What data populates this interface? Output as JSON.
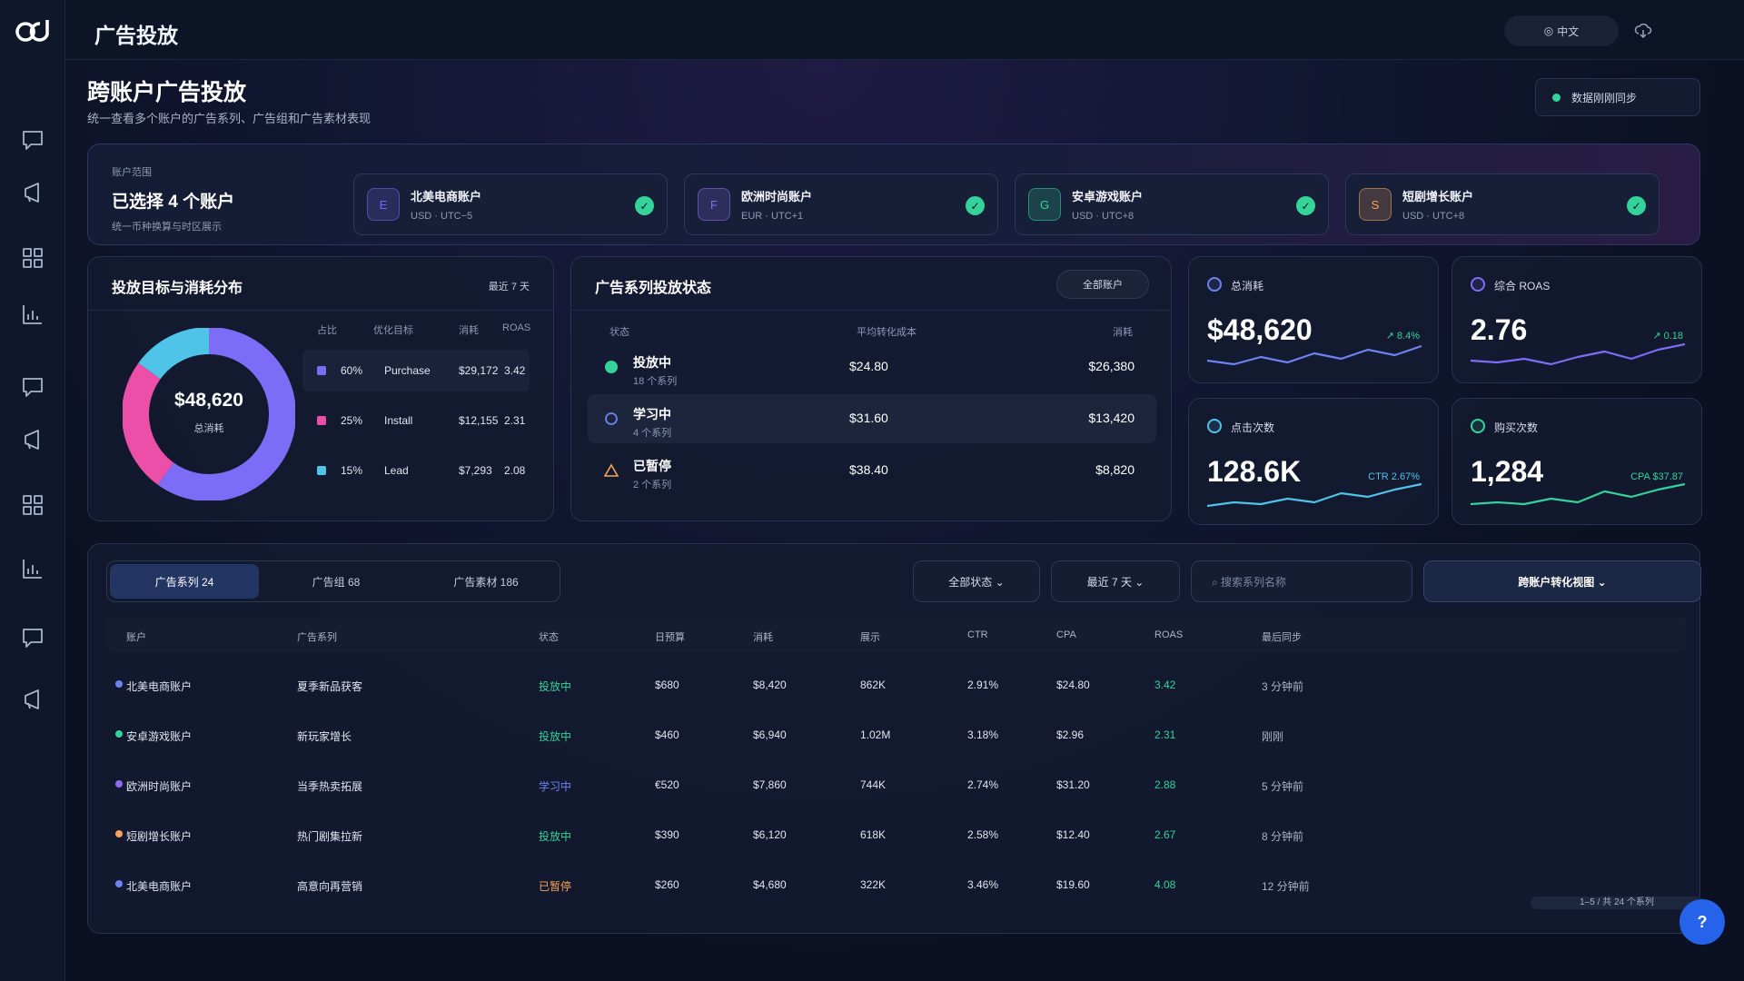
{
  "app": {
    "title": "广告投放",
    "language": "中文",
    "brand_color": "#2563eb"
  },
  "sidebar": {
    "items": [
      "chat-icon",
      "megaphone-icon",
      "grid-icon",
      "bar-chart-icon",
      "chat-icon",
      "megaphone-icon",
      "grid-icon",
      "bar-chart-icon",
      "chat-icon",
      "megaphone-icon"
    ]
  },
  "page": {
    "title": "跨账户广告投放",
    "subtitle": "统一查看多个账户的广告系列、广告组和广告素材表现",
    "sync_status": "数据刚刚同步"
  },
  "scope": {
    "label": "账户范围",
    "title": "已选择 4 个账户",
    "note": "统一币种换算与时区展示",
    "accounts": [
      {
        "initial": "E",
        "name": "北美电商账户",
        "meta": "USD · UTC−5",
        "color": "#6d6af5"
      },
      {
        "initial": "F",
        "name": "欧洲时尚账户",
        "meta": "EUR · UTC+1",
        "color": "#8b6cf0"
      },
      {
        "initial": "G",
        "name": "安卓游戏账户",
        "meta": "USD · UTC+8",
        "color": "#34d399"
      },
      {
        "initial": "S",
        "name": "短剧增长账户",
        "meta": "USD · UTC+8",
        "color": "#f5a35b"
      }
    ]
  },
  "distribution": {
    "title": "投放目标与消耗分布",
    "range": "最近 7 天",
    "total": "$48,620",
    "total_label": "总消耗",
    "headers": {
      "share": "占比",
      "goal": "优化目标",
      "spend": "消耗",
      "roas": "ROAS"
    },
    "rows": [
      {
        "share": "60%",
        "goal": "Purchase",
        "spend": "$29,172",
        "roas": "3.42",
        "color": "#7c6cf6"
      },
      {
        "share": "25%",
        "goal": "Install",
        "spend": "$12,155",
        "roas": "2.31",
        "color": "#ec4fa8"
      },
      {
        "share": "15%",
        "goal": "Lead",
        "spend": "$7,293",
        "roas": "2.08",
        "color": "#4fc3e8"
      }
    ]
  },
  "campaign_status": {
    "title": "广告系列投放状态",
    "filter": "全部账户",
    "headers": {
      "status": "状态",
      "cpa": "平均转化成本",
      "spend": "消耗"
    },
    "rows": [
      {
        "name": "投放中",
        "sub": "18 个系列",
        "cpa": "$24.80",
        "spend": "$26,380",
        "icon": "active-dot-icon",
        "color": "#34d399"
      },
      {
        "name": "学习中",
        "sub": "4 个系列",
        "cpa": "$31.60",
        "spend": "$13,420",
        "icon": "learning-ring-icon",
        "color": "#6d83f2"
      },
      {
        "name": "已暂停",
        "sub": "2 个系列",
        "cpa": "$38.40",
        "spend": "$8,820",
        "icon": "warning-triangle-icon",
        "color": "#f5a35b"
      }
    ]
  },
  "kpis": [
    {
      "label": "总消耗",
      "value": "$48,620",
      "trend": "↗ 8.4%",
      "color": "#6d83f2",
      "trend_color": "#34d399",
      "spark": [
        10,
        6,
        14,
        8,
        18,
        12,
        22,
        16,
        26
      ]
    },
    {
      "label": "综合 ROAS",
      "value": "2.76",
      "trend": "↗ 0.18",
      "color": "#7c6cf6",
      "trend_color": "#34d399",
      "spark": [
        10,
        8,
        12,
        6,
        14,
        20,
        12,
        22,
        28
      ]
    },
    {
      "label": "点击次数",
      "value": "128.6K",
      "trend": "CTR 2.67%",
      "color": "#4fc3e8",
      "trend_color": "#4fc3e8",
      "spark": [
        6,
        10,
        8,
        14,
        10,
        20,
        16,
        24,
        30
      ]
    },
    {
      "label": "购买次数",
      "value": "1,284",
      "trend": "CPA $37.87",
      "color": "#34d399",
      "trend_color": "#34d399",
      "spark": [
        8,
        10,
        8,
        14,
        10,
        22,
        16,
        24,
        30
      ]
    }
  ],
  "table": {
    "tabs": [
      "广告系列 24",
      "广告组 68",
      "广告素材 186"
    ],
    "filters": {
      "status": "全部状态 ⌄",
      "range": "最近 7 天 ⌄",
      "search_placeholder": "⌕ 搜索系列名称",
      "view": "跨账户转化视图 ⌄"
    },
    "headers": [
      "账户",
      "广告系列",
      "状态",
      "日预算",
      "消耗",
      "展示",
      "CTR",
      "CPA",
      "ROAS",
      "最后同步"
    ],
    "rows": [
      {
        "account": "北美电商账户",
        "dot": "#6d83f2",
        "campaign": "夏季新品获客",
        "status": "投放中",
        "status_color": "#34d399",
        "budget": "$680",
        "spend": "$8,420",
        "impr": "862K",
        "ctr": "2.91%",
        "cpa": "$24.80",
        "roas": "3.42",
        "sync": "3 分钟前"
      },
      {
        "account": "安卓游戏账户",
        "dot": "#34d399",
        "campaign": "新玩家增长",
        "status": "投放中",
        "status_color": "#34d399",
        "budget": "$460",
        "spend": "$6,940",
        "impr": "1.02M",
        "ctr": "3.18%",
        "cpa": "$2.96",
        "roas": "2.31",
        "sync": "刚刚"
      },
      {
        "account": "欧洲时尚账户",
        "dot": "#8b6cf0",
        "campaign": "当季热卖拓展",
        "status": "学习中",
        "status_color": "#6d83f2",
        "budget": "€520",
        "spend": "$7,860",
        "impr": "744K",
        "ctr": "2.74%",
        "cpa": "$31.20",
        "roas": "2.88",
        "sync": "5 分钟前"
      },
      {
        "account": "短剧增长账户",
        "dot": "#f5a35b",
        "campaign": "热门剧集拉新",
        "status": "投放中",
        "status_color": "#34d399",
        "budget": "$390",
        "spend": "$6,120",
        "impr": "618K",
        "ctr": "2.58%",
        "cpa": "$12.40",
        "roas": "2.67",
        "sync": "8 分钟前"
      },
      {
        "account": "北美电商账户",
        "dot": "#6d83f2",
        "campaign": "高意向再营销",
        "status": "已暂停",
        "status_color": "#f5a35b",
        "budget": "$260",
        "spend": "$4,680",
        "impr": "322K",
        "ctr": "3.46%",
        "cpa": "$19.60",
        "roas": "4.08",
        "sync": "12 分钟前"
      }
    ],
    "pagination": "1–5 / 共 24 个系列"
  },
  "help": "?"
}
